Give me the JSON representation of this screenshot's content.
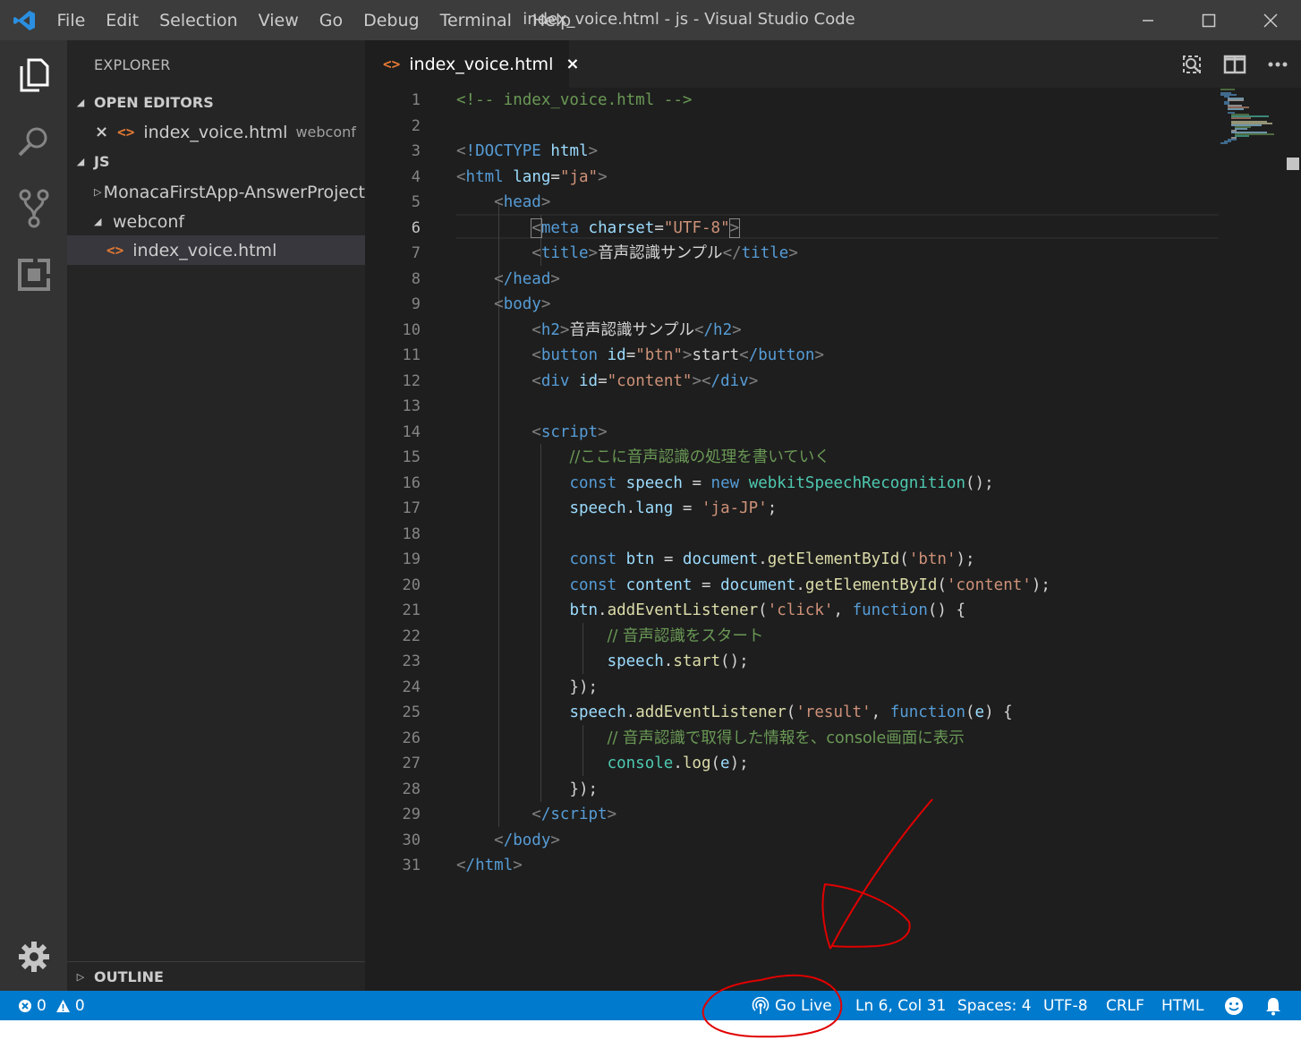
{
  "window": {
    "title": "index_voice.html - js - Visual Studio Code",
    "menu": [
      "File",
      "Edit",
      "Selection",
      "View",
      "Go",
      "Debug",
      "Terminal",
      "Help"
    ],
    "controls": [
      "minimize-icon",
      "maximize-icon",
      "close-icon"
    ]
  },
  "activity_bar": {
    "items": [
      "explorer-icon",
      "search-icon",
      "source-control-icon",
      "extensions-icon"
    ],
    "bottom": "settings-gear-icon"
  },
  "sidebar": {
    "title": "EXPLORER",
    "open_editors": {
      "label": "OPEN EDITORS",
      "items": [
        {
          "name": "index_voice.html",
          "description": "webconf"
        }
      ]
    },
    "folder": {
      "label": "JS",
      "items": [
        {
          "name": "MonacaFirstApp-AnswerProject",
          "type": "folder",
          "expanded": false
        },
        {
          "name": "webconf",
          "type": "folder",
          "expanded": true
        },
        {
          "name": "index_voice.html",
          "type": "file",
          "active": true
        }
      ]
    },
    "outline": {
      "label": "OUTLINE"
    }
  },
  "editor": {
    "tab": {
      "label": "index_voice.html"
    },
    "actions": [
      "open-preview-icon",
      "split-editor-icon",
      "more-actions-icon"
    ],
    "current_line": 6,
    "line_numbers": [
      "1",
      "2",
      "3",
      "4",
      "5",
      "6",
      "7",
      "8",
      "9",
      "10",
      "11",
      "12",
      "13",
      "14",
      "15",
      "16",
      "17",
      "18",
      "19",
      "20",
      "21",
      "22",
      "23",
      "24",
      "25",
      "26",
      "27",
      "28",
      "29",
      "30",
      "31"
    ],
    "code": {
      "l1": "<!-- index_voice.html -->",
      "l3_doctype": "!DOCTYPE",
      "l3_html": "html",
      "l4_tag": "html",
      "l4_attr": "lang",
      "l4_val": "\"ja\"",
      "l5_tag": "head",
      "l6_tag": "meta",
      "l6_attr": "charset",
      "l6_val": "\"UTF-8\"",
      "l7_tag": "title",
      "l7_text": "音声認識サンプル",
      "l8_tag": "/head",
      "l9_tag": "body",
      "l10_tag": "h2",
      "l10_text": "音声認識サンプル",
      "l10_close": "/h2",
      "l11_tag": "button",
      "l11_attr": "id",
      "l11_val": "\"btn\"",
      "l11_text": "start",
      "l11_close": "/button",
      "l12_tag": "div",
      "l12_attr": "id",
      "l12_val": "\"content\"",
      "l12_close": "/div",
      "l14_tag": "script",
      "l15_comment": "//ここに音声認識の処理を書いていく",
      "l16_const": "const",
      "l16_var": "speech",
      "l16_new": "new",
      "l16_class": "webkitSpeechRecognition",
      "l16_rest": "();",
      "l17_var": "speech",
      "l17_prop": "lang",
      "l17_val": "'ja-JP'",
      "l19_const": "const",
      "l19_var": "btn",
      "l19_obj": "document",
      "l19_fn": "getElementById",
      "l19_arg": "'btn'",
      "l20_const": "const",
      "l20_var": "content",
      "l20_obj": "document",
      "l20_fn": "getElementById",
      "l20_arg": "'content'",
      "l21_var": "btn",
      "l21_fn": "addEventListener",
      "l21_arg": "'click'",
      "l21_kw": "function",
      "l22_comment": "// 音声認識をスタート",
      "l23_var": "speech",
      "l23_fn": "start",
      "l24_text": "});",
      "l25_var": "speech",
      "l25_fn": "addEventListener",
      "l25_arg": "'result'",
      "l25_kw": "function",
      "l25_param": "e",
      "l26_comment": "// 音声認識で取得した情報を、console画面に表示",
      "l27_obj": "console",
      "l27_fn": "log",
      "l27_arg": "e",
      "l28_text": "});",
      "l29_tag": "/script",
      "l30_tag": "/body",
      "l31_tag": "/html"
    }
  },
  "status_bar": {
    "errors": "0",
    "warnings": "0",
    "go_live": "Go Live",
    "position": "Ln 6, Col 31",
    "indent": "Spaces: 4",
    "encoding": "UTF-8",
    "eol": "CRLF",
    "language": "HTML",
    "feedback_icon": "smiley-icon",
    "notifications_icon": "bell-icon"
  },
  "colors": {
    "status_bar": "#007acc",
    "annotation": "#e00000",
    "html_icon": "#e37933"
  }
}
